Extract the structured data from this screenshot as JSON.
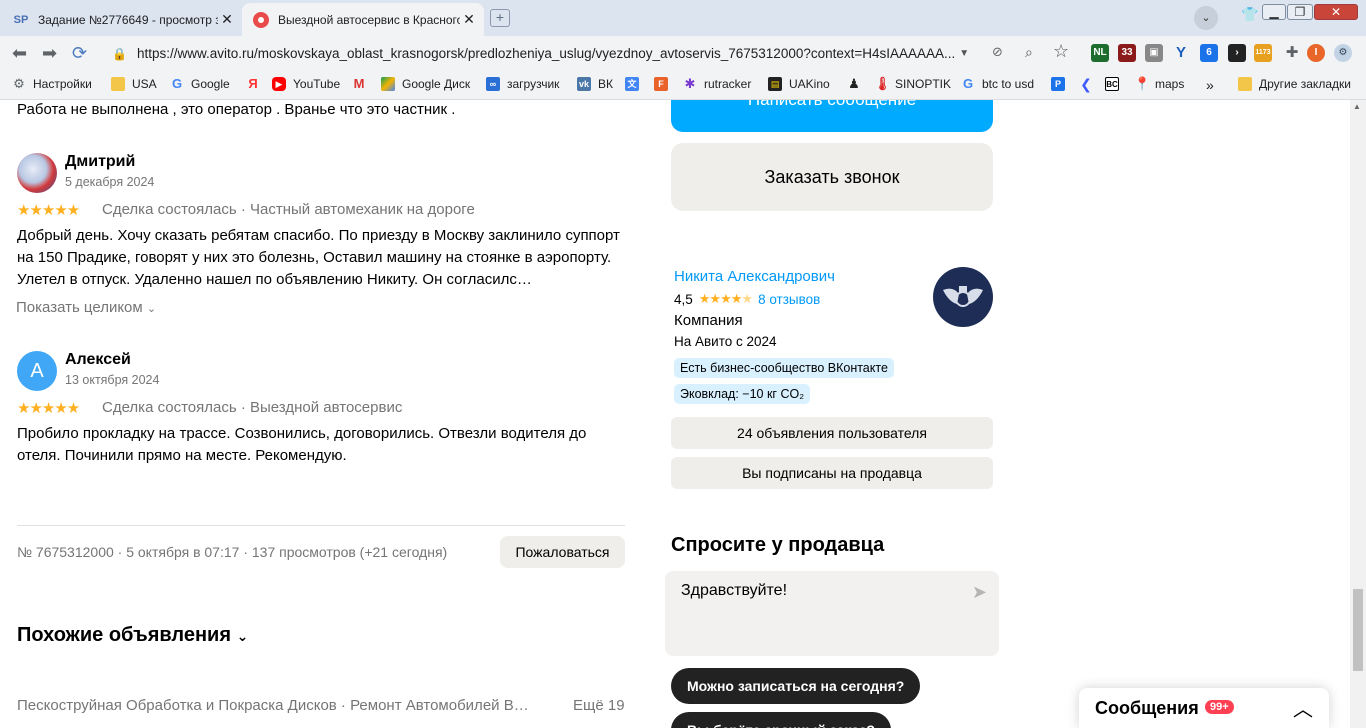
{
  "browser": {
    "tabs": [
      {
        "title": "Задание №2776649 - просмотр з",
        "favicon": "SP"
      },
      {
        "title": "Выездной автосервис в Красногорс",
        "favicon": "avito"
      }
    ],
    "url": "https://www.avito.ru/moskovskaya_oblast_krasnogorsk/predlozheniya_uslug/vyezdnoy_avtoservis_7675312000?context=H4sIAAAAAA...",
    "bookmarks": [
      "Настройки",
      "USA",
      "Google",
      "YouTube",
      "Google Диск",
      "загрузчик",
      "ВК",
      "rutracker",
      "UAKino",
      "SINOPTIK",
      "btc to usd",
      "maps",
      "Другие закладки"
    ],
    "ext_badges": {
      "nl": "NL",
      "b33": "33",
      "b6": "6",
      "b1173": "1173"
    }
  },
  "reviews": {
    "truncated_top": "Работа не выполнена , это оператор . Вранье что это частник .",
    "items": [
      {
        "name": "Дмитрий",
        "date": "5 декабря 2024",
        "rating": 5,
        "meta": "Сделка состоялась · Частный автомеханик на дороге",
        "text": "Добрый день. Хочу сказать ребятам спасибо. По приезду в Москву заклинило суппорт на 150 Прадике, говорят у них это болезнь, Оставил машину на стоянке в аэропорту. Улетел в отпуск. Удаленно нашел по объявлению Никиту. Он согласилс…",
        "show_all": "Показать целиком"
      },
      {
        "name": "Алексей",
        "avatar_letter": "А",
        "date": "13 октября 2024",
        "rating": 5,
        "meta": "Сделка состоялась · Выездной автосервис",
        "text": "Пробило прокладку на трассе. Созвонились, договорились. Отвезли водителя до отеля. Починили прямо на месте. Рекомендую."
      }
    ]
  },
  "listing_footer": {
    "info": "№ 7675312000 · 5 октября в 07:17 · 137 просмотров (+21 сегодня)",
    "report": "Пожаловаться"
  },
  "similar": {
    "title": "Похожие объявления",
    "first_item": "Пескоструйная Обработка и Покраска Дисков · Ремонт Автомобилей В…",
    "more": "Ещё 19"
  },
  "sidebar": {
    "write_button": "Написать сообщение",
    "call_button": "Заказать звонок",
    "seller": {
      "name": "Никита Александрович",
      "rating": "4,5",
      "stars": 4.5,
      "reviews": "8 отзывов",
      "type": "Компания",
      "since": "На Авито с 2024",
      "badges": [
        "Есть бизнес-сообщество ВКонтакте",
        "Эковклад: −10 кг CO₂"
      ],
      "ads_button": "24 объявления пользователя",
      "subscribed_button": "Вы подписаны на продавца"
    },
    "ask": {
      "title": "Спросите у продавца",
      "message": "Здравствуйте!",
      "quick_replies": [
        "Можно записаться на сегодня?",
        "Вы берёте срочный заказ?"
      ]
    }
  },
  "messages_widget": {
    "label": "Сообщения",
    "badge": "99+"
  },
  "colors": {
    "accent": "#00aaff",
    "link": "#0099f7",
    "star": "#ffb021",
    "dark_btn": "#222222"
  }
}
